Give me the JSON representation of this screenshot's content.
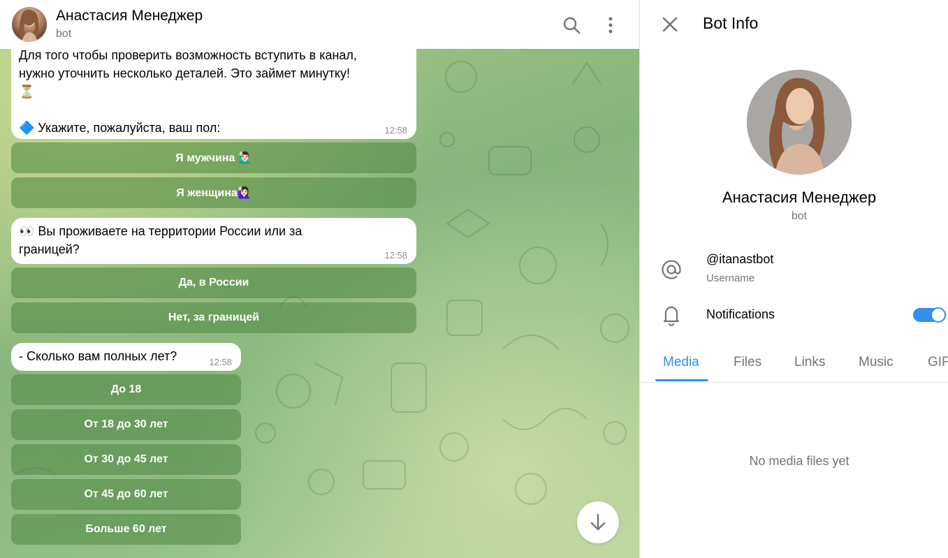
{
  "chat": {
    "header": {
      "title": "Анастасия Менеджер",
      "subtitle": "bot"
    },
    "messages": [
      {
        "lines": [
          "Для того чтобы проверить возможность вступить в канал,",
          "нужно уточнить несколько деталей. Это займет минутку!",
          "⏳",
          "",
          "🔷 Укажите, пожалуйста, ваш пол:"
        ],
        "time": "12:58",
        "buttons": [
          "Я мужчина 🙋🏻‍♂️",
          "Я женщина🙋🏻‍♀️"
        ]
      },
      {
        "lines": [
          "👀 Вы проживаете на территории России или за",
          "границей?"
        ],
        "time": "12:58",
        "buttons": [
          "Да, в России",
          "Нет, за границей"
        ]
      },
      {
        "lines": [
          "- Сколько вам полных лет?"
        ],
        "time": "12:58",
        "buttons": [
          "До 18",
          "От 18 до 30 лет",
          "От 30 до 45 лет",
          "От 45 до 60 лет",
          "Больше 60 лет"
        ]
      }
    ]
  },
  "panel": {
    "title": "Bot Info",
    "name": "Анастасия Менеджер",
    "subtitle": "bot",
    "username": "@itanastbot",
    "username_caption": "Username",
    "notifications_label": "Notifications",
    "notifications_enabled": true,
    "tabs": [
      "Media",
      "Files",
      "Links",
      "Music",
      "GIF"
    ],
    "active_tab": "Media",
    "empty_text": "No media files yet"
  },
  "colors": {
    "accent": "#3390ec",
    "keyboard_button": "#4c8640",
    "secondary_text": "#707579"
  },
  "icons": {
    "header": [
      "search-icon",
      "more-vertical-icon"
    ],
    "panel": [
      "close-icon",
      "at-sign-icon",
      "bell-icon"
    ],
    "chat": [
      "arrow-down-icon"
    ]
  }
}
